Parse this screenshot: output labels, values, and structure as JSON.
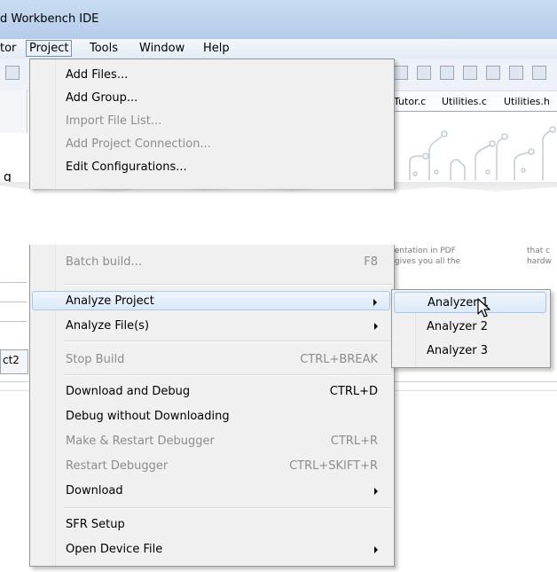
{
  "window": {
    "title": "d Workbench IDE"
  },
  "menubar": {
    "items": [
      {
        "label": "tor"
      },
      {
        "label": "Project"
      },
      {
        "label": "Tools"
      },
      {
        "label": "Window"
      },
      {
        "label": "Help"
      }
    ]
  },
  "tabs": [
    "Tutor.c",
    "Utilities.c",
    "Utilities.h"
  ],
  "side_fragments": {
    "g": "g",
    "ct2": "ct2"
  },
  "background_text": {
    "line1": "mentation in PDF",
    "line2": "it gives you all the",
    "col2_line1": "that c",
    "col2_line2": "hardw"
  },
  "project_menu": {
    "upper_items": [
      {
        "label": "Add Files...",
        "enabled": true
      },
      {
        "label": "Add Group...",
        "enabled": true
      },
      {
        "label": "Import File List...",
        "enabled": false
      },
      {
        "label": "Add Project Connection...",
        "enabled": false
      },
      {
        "label": "Edit Configurations...",
        "enabled": true
      }
    ],
    "lower_items": [
      {
        "label": "Batch build...",
        "shortcut": "F8",
        "enabled": false
      },
      {
        "label": "Analyze Project",
        "enabled": true,
        "submenu": true,
        "highlighted": true
      },
      {
        "label": "Analyze File(s)",
        "enabled": true,
        "submenu": true
      },
      {
        "label": "Stop Build",
        "shortcut": "CTRL+BREAK",
        "enabled": false
      },
      {
        "label": "Download and Debug",
        "shortcut": "CTRL+D",
        "enabled": true
      },
      {
        "label": "Debug without Downloading",
        "enabled": true
      },
      {
        "label": "Make & Restart Debugger",
        "shortcut": "CTRL+R",
        "enabled": false
      },
      {
        "label": "Restart Debugger",
        "shortcut": "CTRL+SKIFT+R",
        "enabled": false
      },
      {
        "label": "Download",
        "enabled": true,
        "submenu": true
      },
      {
        "label": "SFR Setup",
        "enabled": true
      },
      {
        "label": "Open Device File",
        "enabled": true,
        "submenu": true
      }
    ]
  },
  "analyze_submenu": {
    "items": [
      {
        "label": "Analyzer 1",
        "highlighted": true
      },
      {
        "label": "Analyzer 2"
      },
      {
        "label": "Analyzer 3"
      }
    ]
  }
}
